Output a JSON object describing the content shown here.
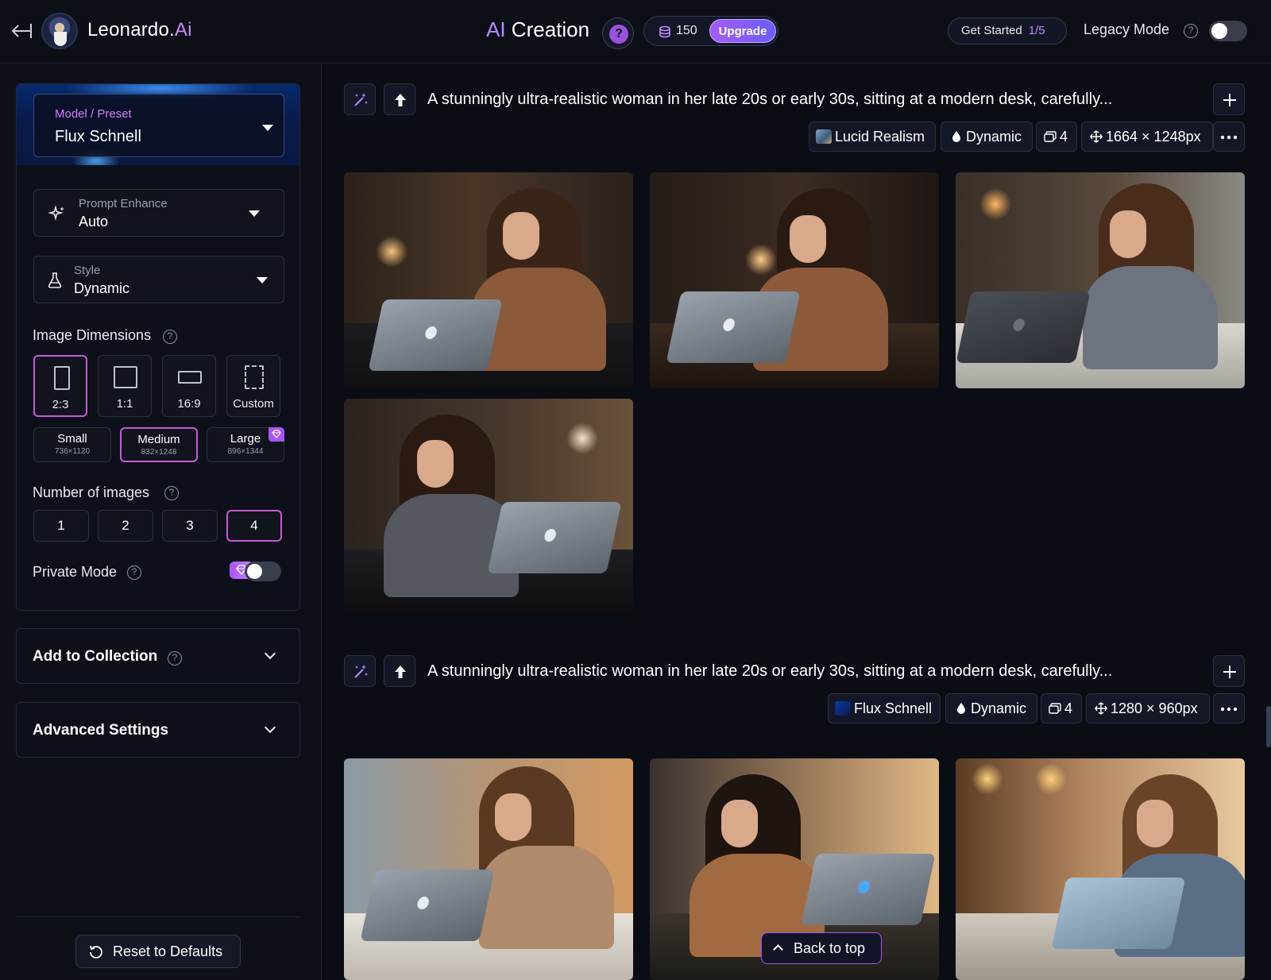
{
  "header": {
    "brand_name": "Leonardo.",
    "brand_ai": "Ai",
    "page_title_ai": "AI",
    "page_title_rest": " Creation",
    "help_symbol": "?",
    "credits": "150",
    "upgrade_label": "Upgrade",
    "get_started_label": "Get Started",
    "get_started_progress": "1/5",
    "legacy_mode_label": "Legacy Mode",
    "legacy_mode_on": false
  },
  "sidebar": {
    "model_label": "Model / Preset",
    "model_value": "Flux Schnell",
    "prompt_enhance_label": "Prompt Enhance",
    "prompt_enhance_value": "Auto",
    "style_label": "Style",
    "style_value": "Dynamic",
    "dimensions_title": "Image Dimensions",
    "ratios": [
      {
        "label": "2:3",
        "active": true
      },
      {
        "label": "1:1",
        "active": false
      },
      {
        "label": "16:9",
        "active": false
      },
      {
        "label": "Custom",
        "active": false
      }
    ],
    "sizes": [
      {
        "name": "Small",
        "dims": "736×1120",
        "active": false,
        "premium": false
      },
      {
        "name": "Medium",
        "dims": "832×1248",
        "active": true,
        "premium": false
      },
      {
        "name": "Large",
        "dims": "896×1344",
        "active": false,
        "premium": true
      }
    ],
    "num_images_title": "Number of images",
    "num_options": [
      "1",
      "2",
      "3",
      "4"
    ],
    "num_selected": "4",
    "private_mode_label": "Private Mode",
    "private_mode_on": false,
    "add_to_collection_label": "Add to Collection",
    "advanced_settings_label": "Advanced Settings",
    "reset_label": "Reset to Defaults"
  },
  "generations": [
    {
      "prompt": "A stunningly ultra-realistic woman in her late 20s or early 30s, sitting at a modern desk, carefully...",
      "model_chip": "Lucid Realism",
      "style_chip": "Dynamic",
      "count_chip": "4",
      "dims_chip": "1664 × 1248px",
      "images": [
        "woman-laptop-1",
        "woman-laptop-2",
        "woman-laptop-3",
        "woman-laptop-4"
      ]
    },
    {
      "prompt": "A stunningly ultra-realistic woman in her late 20s or early 30s, sitting at a modern desk, carefully...",
      "model_chip": "Flux Schnell",
      "style_chip": "Dynamic",
      "count_chip": "4",
      "dims_chip": "1280 × 960px",
      "images": [
        "woman-laptop-5",
        "woman-laptop-6",
        "woman-laptop-7"
      ]
    }
  ],
  "back_to_top_label": "Back to top",
  "colors": {
    "accent_purple": "#a855f7",
    "active_border": "#c45bd6",
    "background": "#0b0d14"
  }
}
